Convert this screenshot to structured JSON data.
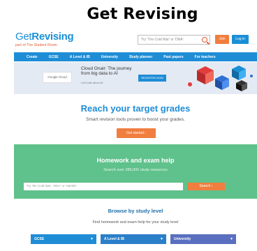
{
  "caption": "Get Revising",
  "header": {
    "logo_prefix": "Get",
    "logo_main": "Revising",
    "logo_sub": "part of The Student Room",
    "search_placeholder": "Try 'The Cold War' or 'DNA'",
    "join_label": "Join",
    "login_label": "Log in"
  },
  "nav": {
    "items": [
      "Create",
      "GCSE",
      "A Level & IB",
      "University",
      "Study planner",
      "Past papers",
      "For teachers"
    ]
  },
  "ad": {
    "brand": "Google Cloud",
    "title": "Cloud Onair: The journey from big data to AI",
    "small": "Let's talk about AI",
    "cta": "REGISTER NOW"
  },
  "hero": {
    "title": "Reach your target grades",
    "subtitle": "Smart revision tools proven to boost your grades.",
    "cta": "Get started ›"
  },
  "homework": {
    "title": "Homework and exam help",
    "subtitle": "Search over 285,000 study resources",
    "input_placeholder": "Try 'the Cold War', 'DNA' or 'Hamlet'",
    "search_label": "Search ›"
  },
  "browse": {
    "title": "Browse by study level",
    "subtitle": "Find homework and exam help for your study level",
    "levels": [
      {
        "label": "GCSE",
        "color": "#1f8dd6"
      },
      {
        "label": "A Level & IB",
        "color": "#2b7fc9"
      },
      {
        "label": "University",
        "color": "#5a6fbf"
      }
    ]
  },
  "colors": {
    "brand_blue": "#1f8dd6",
    "orange": "#f07e3f",
    "green": "#5fc18b"
  }
}
